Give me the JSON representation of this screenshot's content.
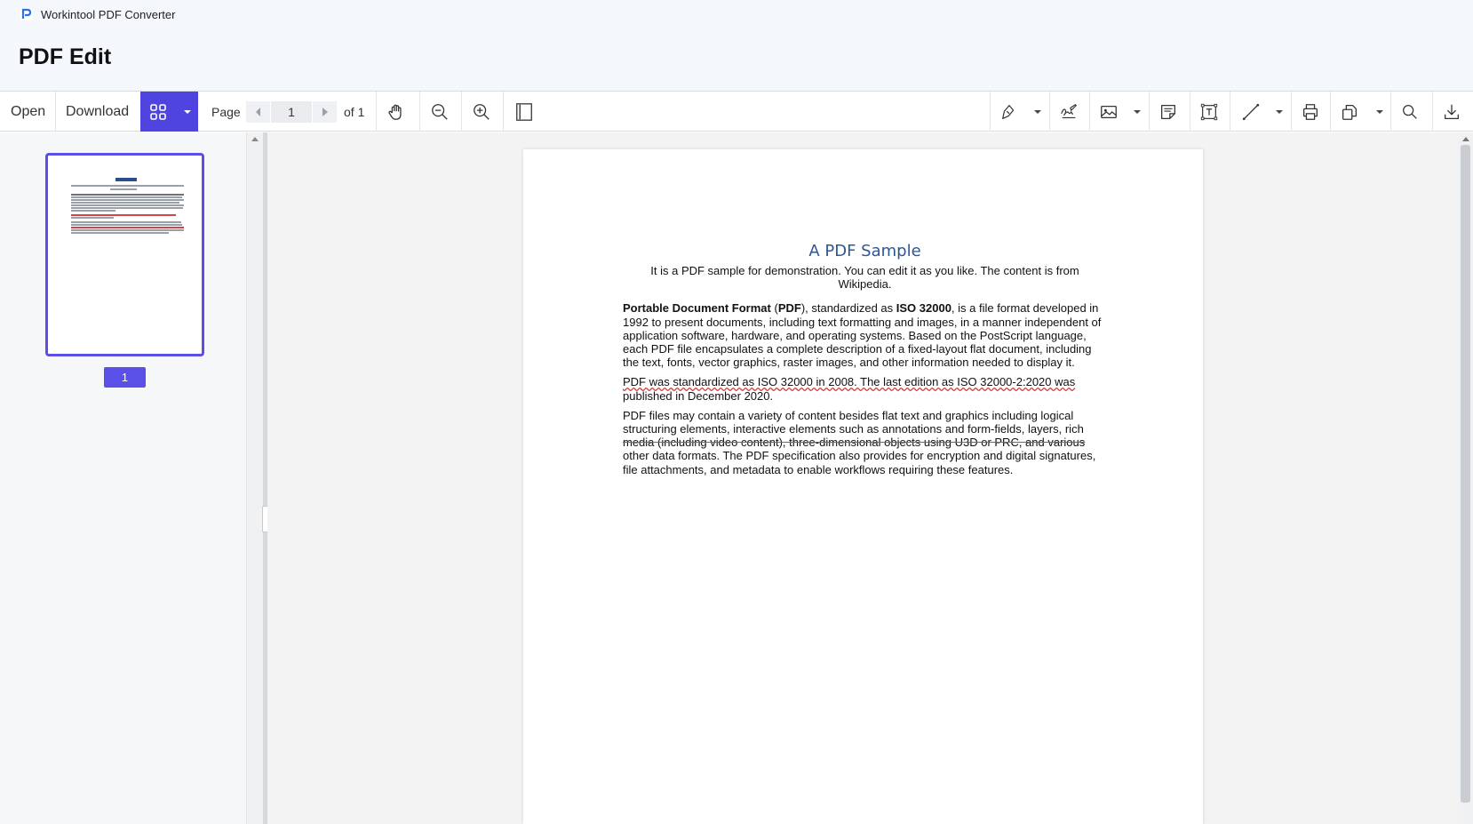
{
  "app": {
    "title": "Workintool PDF Converter",
    "logo_icon": "workintool-logo-icon",
    "brand_color": "#4f44e0"
  },
  "header": {
    "title": "PDF Edit"
  },
  "toolbar": {
    "open_label": "Open",
    "download_label": "Download",
    "page_label": "Page",
    "page_value": "1",
    "of_label": "of 1",
    "icons": [
      "thumbnails-grid-icon",
      "hand-pan-icon",
      "zoom-out-icon",
      "zoom-in-icon",
      "single-page-view-icon",
      "highlight-pen-icon",
      "signature-icon",
      "image-icon",
      "note-icon",
      "text-box-icon",
      "line-draw-icon",
      "print-icon",
      "export-icon",
      "search-icon",
      "download-icon"
    ]
  },
  "sidebar": {
    "thumbnail_page_number": "1"
  },
  "document": {
    "title": "A PDF Sample",
    "subtitle": "It is a PDF sample for demonstration. You can edit it as you like. The content is from Wikipedia.",
    "p1_b1": "Portable Document Format",
    "p1_t1": " (",
    "p1_b2": "PDF",
    "p1_t2": "), standardized as ",
    "p1_b3": "ISO 32000",
    "p1_t3": ", is a file format developed in 1992 to present documents, including text formatting and images, in a manner independent of application software, hardware, and operating systems. Based on the PostScript language, each PDF file encapsulates a complete description of a fixed-layout flat document, including the text, fonts, vector graphics, raster images, and other information needed to display it.",
    "p2_underlined": "PDF was standardized as ISO 32000 in 2008. The last edition as ISO 32000-2:2020 was",
    "p2_rest": " published in December 2020.",
    "p3_a": "PDF files may contain a variety of content besides flat text and graphics including logical structuring elements, interactive elements such as annotations and form-fields, layers, rich ",
    "p3_strike": "media (including video content), three-dimensional objects using U3D or PRC, and various",
    "p3_b": " other data formats. The PDF specification also provides for encryption and digital signatures, file attachments, and metadata to enable workflows requiring these features."
  }
}
